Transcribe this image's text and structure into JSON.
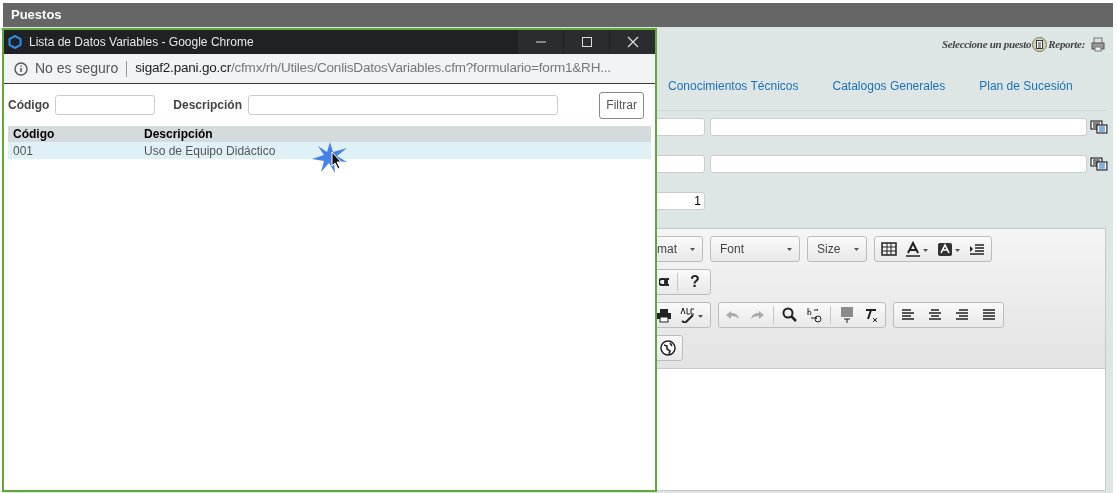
{
  "page": {
    "title": "Puestos",
    "header_text": "Seleccione un puesto",
    "report_label": "Reporte:",
    "tabs": [
      "Conocimientos Técnicos",
      "Catalogos Generales",
      "Plan de Sucesión"
    ],
    "form_rows": [
      {
        "has_description": true,
        "lookup": true
      },
      {
        "has_description": true,
        "lookup": true
      },
      {
        "code": "1"
      }
    ],
    "editor": {
      "dropdowns": [
        "mat",
        "Font",
        "Size"
      ],
      "help_button": "?"
    }
  },
  "popup": {
    "title": "Lista de Datos Variables - Google Chrome",
    "security": "No es seguro",
    "url": {
      "host": "sigaf2.pani.go.cr",
      "path": "/cfmx/rh/Utiles/ConlisDatosVariables.cfm?formulario=form1&RH..."
    },
    "filters": [
      {
        "label": "Código"
      },
      {
        "label": "Descripción"
      }
    ],
    "filter_button": "Filtrar",
    "table": {
      "columns": [
        "Código",
        "Descripción"
      ],
      "rows": [
        {
          "cells": [
            "001",
            "Uso de Equipo Didáctico"
          ],
          "selected": true
        }
      ]
    }
  }
}
